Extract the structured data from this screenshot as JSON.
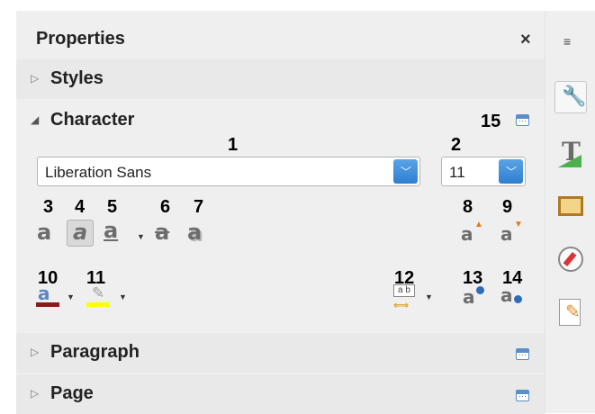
{
  "panel": {
    "title": "Properties",
    "close_glyph": "×"
  },
  "sections": {
    "styles": {
      "label": "Styles"
    },
    "character": {
      "label": "Character"
    },
    "paragraph": {
      "label": "Paragraph"
    },
    "page": {
      "label": "Page"
    }
  },
  "character": {
    "font_name": "Liberation Sans",
    "font_size": "11"
  },
  "callouts": {
    "n1": "1",
    "n2": "2",
    "n3": "3",
    "n4": "4",
    "n5": "5",
    "n6": "6",
    "n7": "7",
    "n8": "8",
    "n9": "9",
    "n10": "10",
    "n11": "11",
    "n12": "12",
    "n13": "13",
    "n14": "14",
    "n15": "15"
  },
  "icons": {
    "bold": "bold-icon",
    "italic": "italic-icon",
    "underline": "underline-icon",
    "strikethrough": "strikethrough-icon",
    "shadow": "shadow-icon",
    "increase_size": "increase-font-size-icon",
    "decrease_size": "decrease-font-size-icon",
    "font_color": "font-color-icon",
    "highlight": "highlighting-color-icon",
    "spacing": "character-spacing-icon",
    "superscript": "superscript-icon",
    "subscript": "subscript-icon"
  },
  "colors": {
    "accent_blue": "#3a86d4",
    "font_color_bar": "#8b1a1a",
    "highlight_bar": "#ffff00"
  }
}
